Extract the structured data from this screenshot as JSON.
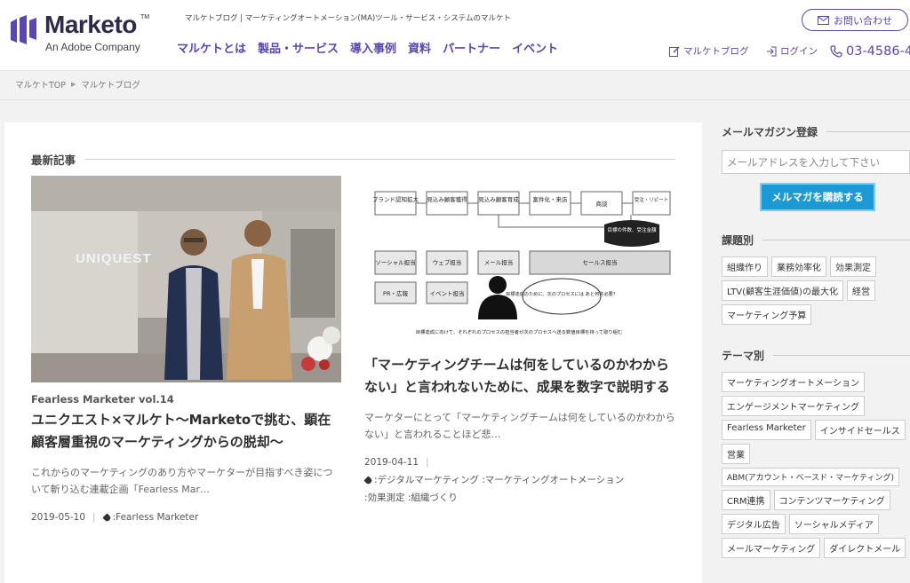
{
  "header": {
    "logo_word": "Marketo",
    "logo_tm": "TM",
    "logo_sub": "An Adobe Company",
    "tagline": "マルケトブログ | マーケティングオートメーション(MA)ツール・サービス・システムのマルケト",
    "nav": [
      "マルケトとは",
      "製品・サービス",
      "導入事例",
      "資料",
      "パートナー",
      "イベント"
    ],
    "contact_label": "お問い合わせ",
    "blog_link": "マルケトブログ",
    "login_link": "ログイン",
    "phone": "03-4586-4"
  },
  "breadcrumb": [
    "マルケトTOP",
    "マルケトブログ"
  ],
  "main": {
    "section_title": "最新記事",
    "articles": [
      {
        "series": "Fearless Marketer vol.14",
        "title": "ユニクエスト×マルケト〜Marketoで挑む、顕在顧客層重視のマーケティングからの脱却〜",
        "excerpt": "これからのマーケティングのあり方やマーケターが目指すべき姿について斬り込む連載企画「Fearless Mar…",
        "date": "2019-05-10",
        "tags": ":Fearless Marketer",
        "photo_sign": "UNIQUEST"
      },
      {
        "title": "「マーケティングチームは何をしているのかわからない」と言われないために、成果を数字で説明する",
        "excerpt": "マーケターにとって「マーケティングチームは何をしているのかわからない」と言われることほど悲…",
        "date": "2019-04-11",
        "tags_line1": ":デジタルマーケティング :マーケティングオートメーション",
        "tags_line2": ":効果測定 :組織づくり",
        "diagram": {
          "top_row": [
            "ブランド認知拡大",
            "見込み顧客獲得",
            "見込み顧客育成",
            "案件化・来店",
            "商談",
            "受注・リピート"
          ],
          "owners": [
            "ソーシャル担当",
            "ウェブ担当",
            "メール担当",
            "セールス担当"
          ],
          "owners2": [
            "PR・広報",
            "イベント担当"
          ],
          "bubble1": "目標の件数、受注金額",
          "bubble2": "目標達成のために、次のプロセスには あと何件必要？",
          "caption": "目標達成に向けて、それぞれのプロセスの担当者が次のプロセスへ送る数値目標を持って取り組む"
        }
      }
    ]
  },
  "sidebar": {
    "newsletter_title": "メールマガジン登録",
    "email_placeholder": "メールアドレスを入力して下さい",
    "subscribe_label": "メルマガを購読する",
    "by_issue_title": "課題別",
    "by_issue_tags": [
      "組織作り",
      "業務効率化",
      "効果測定",
      "LTV(顧客生涯価値)の最大化",
      "経営",
      "マーケティング予算"
    ],
    "by_theme_title": "テーマ別",
    "by_theme_tags": [
      "マーケティングオートメーション",
      "エンゲージメントマーケティング",
      "Fearless Marketer",
      "インサイドセールス",
      "営業",
      "ABM(アカウント・ベースド・マーケティング)",
      "CRM連携",
      "コンテンツマーケティング",
      "デジタル広告",
      "ソーシャルメディア",
      "メールマーケティング",
      "ダイレクトメール"
    ]
  },
  "colors": {
    "brand": "#5a46b0",
    "accent": "#1c9ad6"
  }
}
